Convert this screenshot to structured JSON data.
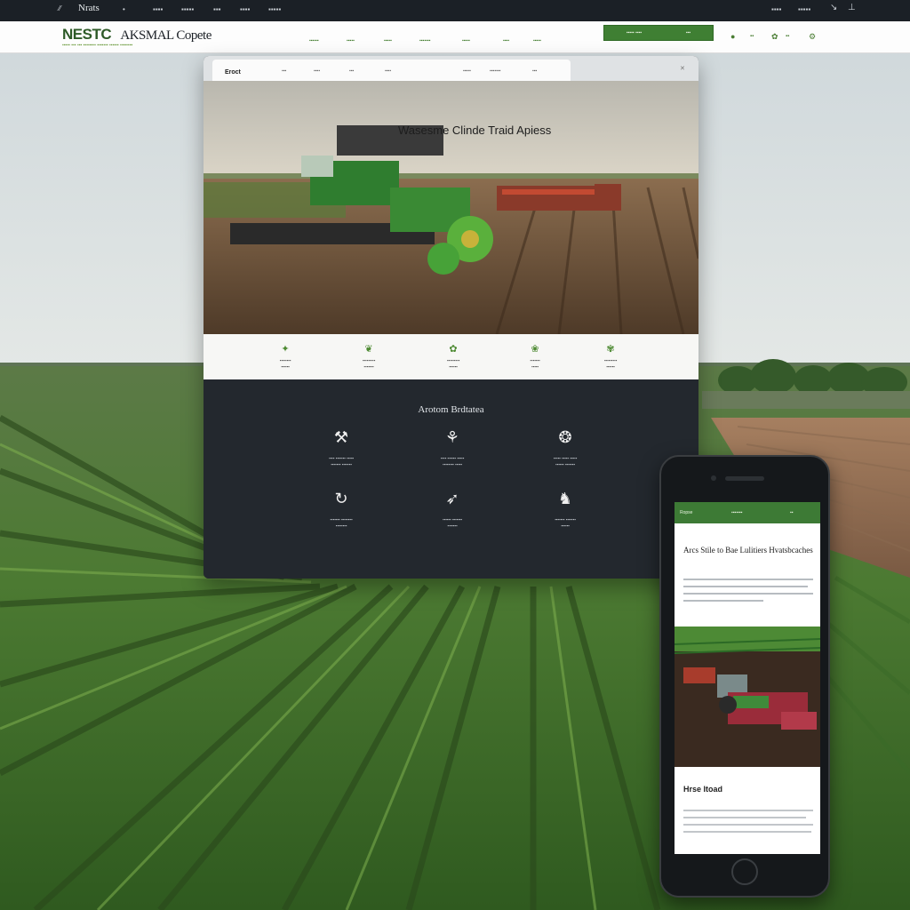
{
  "topbar": {
    "brand": "Nrats",
    "items": [
      "▪▪▪▪",
      "▪▪▪▪▪",
      "▪▪▪",
      "▪▪▪▪",
      "▪▪▪▪▪"
    ]
  },
  "navbar": {
    "logo_a": "NESTC",
    "logo_b": "AKSMAL Copete",
    "tagline": "▪▪▪▪▪ ▪▪▪ ▪▪▪ ▪▪▪▪▪▪▪▪ ▪▪▪▪▪▪▪ ▪▪▪▪▪▪ ▪▪▪▪▪▪▪▪",
    "links": [
      "▪▪▪▪▪▪",
      "▪▪▪▪▪",
      "▪▪▪▪▪",
      "▪▪▪▪▪▪▪",
      "▪▪▪▪▪",
      "▪▪▪▪",
      "▪▪▪▪▪"
    ],
    "cta_left": "▪▪▪▪▪ ▪▪▪▪",
    "cta_right": "▪▪▪"
  },
  "desktop": {
    "active_tab": "Eroct",
    "tabs": [
      "▪▪▪",
      "▪▪▪▪",
      "▪▪▪",
      "▪▪▪▪",
      "▪▪▪▪▪",
      "▪▪▪▪▪▪▪",
      "▪▪▪"
    ],
    "hero_title": "Wasesme Clinde Traid Apiess",
    "features": [
      {
        "t1": "▪▪▪▪▪▪▪▪",
        "t2": "▪▪▪▪▪▪"
      },
      {
        "t1": "▪▪▪▪▪▪▪▪▪",
        "t2": "▪▪▪▪▪▪▪"
      },
      {
        "t1": "▪▪▪▪▪▪▪▪▪",
        "t2": "▪▪▪▪▪▪"
      },
      {
        "t1": "▪▪▪▪▪▪▪",
        "t2": "▪▪▪▪▪"
      },
      {
        "t1": "▪▪▪▪▪▪▪▪▪",
        "t2": "▪▪▪▪▪▪"
      }
    ],
    "dark_title": "Arotom Brdtatea",
    "tiles": [
      {
        "t1": "▪▪▪▪ ▪▪▪▪▪▪▪ ▪▪▪▪▪",
        "t2": "▪▪▪▪▪▪▪ ▪▪▪▪▪▪▪"
      },
      {
        "t1": "▪▪▪▪ ▪▪▪▪▪▪ ▪▪▪▪▪",
        "t2": "▪▪▪▪▪▪▪▪ ▪▪▪▪▪"
      },
      {
        "t1": "▪▪▪▪▪ ▪▪▪▪▪ ▪▪▪▪▪",
        "t2": "▪▪▪▪▪▪ ▪▪▪▪▪▪▪"
      },
      {
        "t1": "▪▪▪▪▪▪▪ ▪▪▪▪▪▪▪▪",
        "t2": "▪▪▪▪▪▪▪▪"
      },
      {
        "t1": "▪▪▪▪▪▪ ▪▪▪▪▪▪▪",
        "t2": "▪▪▪▪▪▪▪"
      },
      {
        "t1": "▪▪▪▪▪▪▪ ▪▪▪▪▪▪▪",
        "t2": "▪▪▪▪▪▪"
      }
    ]
  },
  "phone": {
    "nav_left": "Ropse",
    "nav_mid": "▪▪▪▪▪▪▪",
    "nav_right": "▪▪",
    "headline": "Arcs Stile to Bae Lulitiers Hvatsbcaches",
    "subheading": "Hrse Itoad"
  },
  "colors": {
    "accent": "#3f7f33",
    "dark": "#23282e",
    "topbar": "#1b2026"
  }
}
